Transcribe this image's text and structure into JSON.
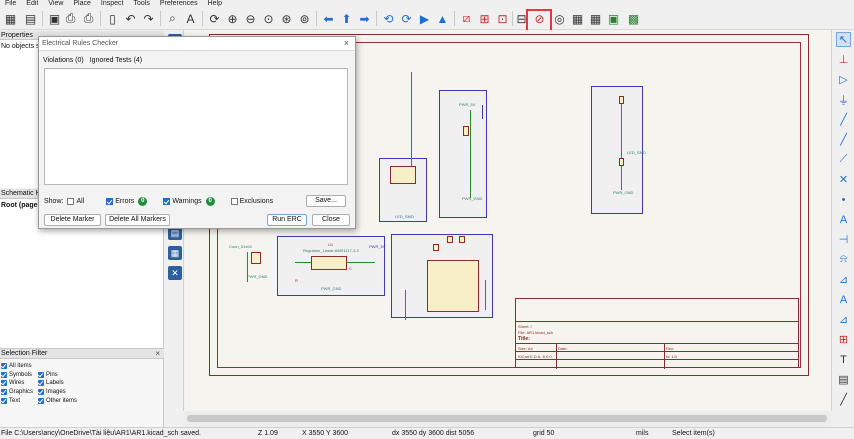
{
  "menu": [
    "File",
    "Edit",
    "View",
    "Place",
    "Inspect",
    "Tools",
    "Preferences",
    "Help"
  ],
  "panels": {
    "properties_title": "Properties",
    "properties_empty": "No objects selected",
    "hierarchy_title": "Schematic Hierarchy",
    "hierarchy_root": "Root (page 1)",
    "selection_filter_title": "Selection Filter",
    "selection_filter_close": "×",
    "filter_items": [
      {
        "label": "All items",
        "checked": true
      },
      {
        "label": "Symbols",
        "checked": true
      },
      {
        "label": "Pins",
        "checked": true
      },
      {
        "label": "Wires",
        "checked": true
      },
      {
        "label": "Labels",
        "checked": true
      },
      {
        "label": "Graphics",
        "checked": true
      },
      {
        "label": "Images",
        "checked": true
      },
      {
        "label": "Text",
        "checked": true
      },
      {
        "label": "Other items",
        "checked": true
      }
    ]
  },
  "dialog": {
    "title": "Electrical Rules Checker",
    "close": "×",
    "tab_violations": "Violations (0)",
    "tab_ignored": "Ignored Tests (4)",
    "show_label": "Show:",
    "filter_all": "All",
    "filter_errors": "Errors",
    "errors_count": "0",
    "filter_warnings": "Warnings",
    "warnings_count": "0",
    "filter_exclusions": "Exclusions",
    "save_button": "Save...",
    "delete_marker": "Delete Marker",
    "delete_all_markers": "Delete All Markers",
    "run_erc": "Run ERC",
    "close_button": "Close"
  },
  "status": {
    "file_message": "File C:\\Users\\ancy\\OneDrive\\Tài liệu\\AR1\\AR1.kicad_sch saved.",
    "zoom": "Z 1.09",
    "cursor": "X 3550  Y 3600",
    "delta": "dx 3550  dy 3600  dist 5056",
    "grid": "grid 50",
    "units": "mils",
    "mode": "Select item(s)"
  },
  "schematic": {
    "title_block": {
      "sheet": "Sheet: /",
      "file": "File: AR1.kicad_sch",
      "title_label": "Title:",
      "size": "Size: A4",
      "date": "Date:",
      "rev": "Rev:",
      "kicad": "KiCad E.D.A. 8.0.0",
      "id": "Id: 1/1"
    },
    "labels": {
      "pwr_gnd": "PWR_GND",
      "pwr_5v": "PWR_5V",
      "regulator": "Regulator_Linear:AMS1117-3.3",
      "conn": "Conn_01x04",
      "led": "LED_SMD",
      "r_label": "R",
      "c_label": "C",
      "u_label": "U1"
    }
  },
  "colors": {
    "accent": "#1f6fd1",
    "highlight": "#e53935",
    "badge_ok": "#1e8e3e",
    "sheet_border": "#8a2a2a",
    "hier_block": "#3b3bb5",
    "wire": "#2b8a2b"
  }
}
